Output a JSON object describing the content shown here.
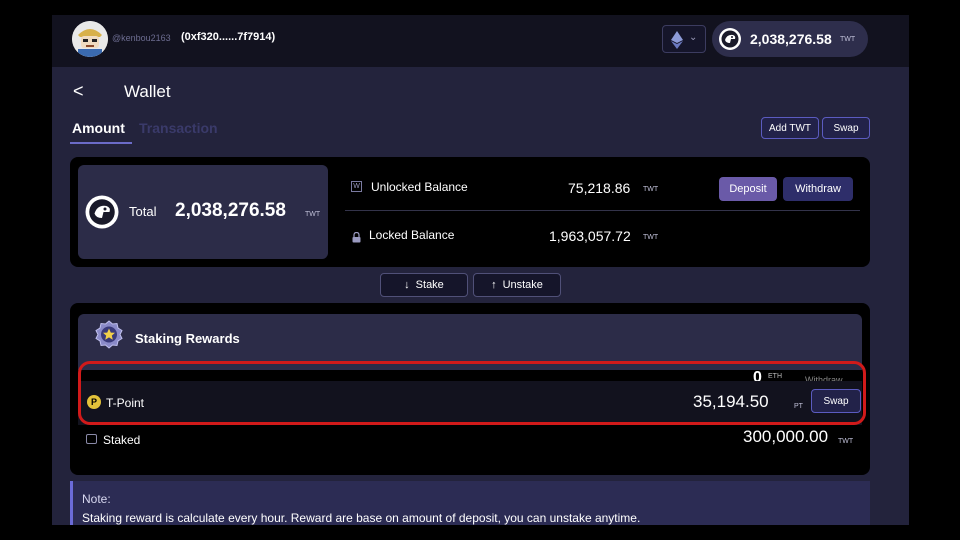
{
  "topbar": {
    "username": "@kenbou2163",
    "address": "(0xf320......7f7914)",
    "network_icon": "ethereum-icon",
    "balance": "2,038,276.58",
    "balance_unit": "TWT"
  },
  "header": {
    "title": "Wallet",
    "tabs": [
      {
        "label": "Amount",
        "active": true
      },
      {
        "label": "Transaction",
        "active": false
      }
    ],
    "add_twt_label": "Add TWT",
    "swap_label": "Swap"
  },
  "balance": {
    "total_label": "Total",
    "total_amount": "2,038,276.58",
    "total_unit": "TWT",
    "unlocked_label": "Unlocked Balance",
    "unlocked_amount": "75,218.86",
    "unlocked_unit": "TWT",
    "locked_label": "Locked Balance",
    "locked_amount": "1,963,057.72",
    "locked_unit": "TWT",
    "deposit_label": "Deposit",
    "withdraw_label": "Withdraw"
  },
  "stake_actions": {
    "stake_label": "Stake",
    "unstake_label": "Unstake"
  },
  "rewards": {
    "title": "Staking Rewards",
    "ghost_amount": "0",
    "ghost_unit": "ETH",
    "ghost_action": "Withdraw",
    "tpoint_label": "T-Point",
    "tpoint_amount": "35,194.50",
    "tpoint_unit": "PT",
    "swap_label": "Swap",
    "staked_label": "Staked",
    "staked_amount": "300,000.00",
    "staked_unit": "TWT"
  },
  "note": {
    "title": "Note:",
    "text": "Staking reward is calculate every hour. Reward are base on amount of deposit, you can unstake anytime."
  },
  "colors": {
    "background": "#23233c",
    "panel": "#000000",
    "accent": "#6b6bc8",
    "deposit": "#6a5aa8",
    "highlight": "#d11a1a"
  }
}
